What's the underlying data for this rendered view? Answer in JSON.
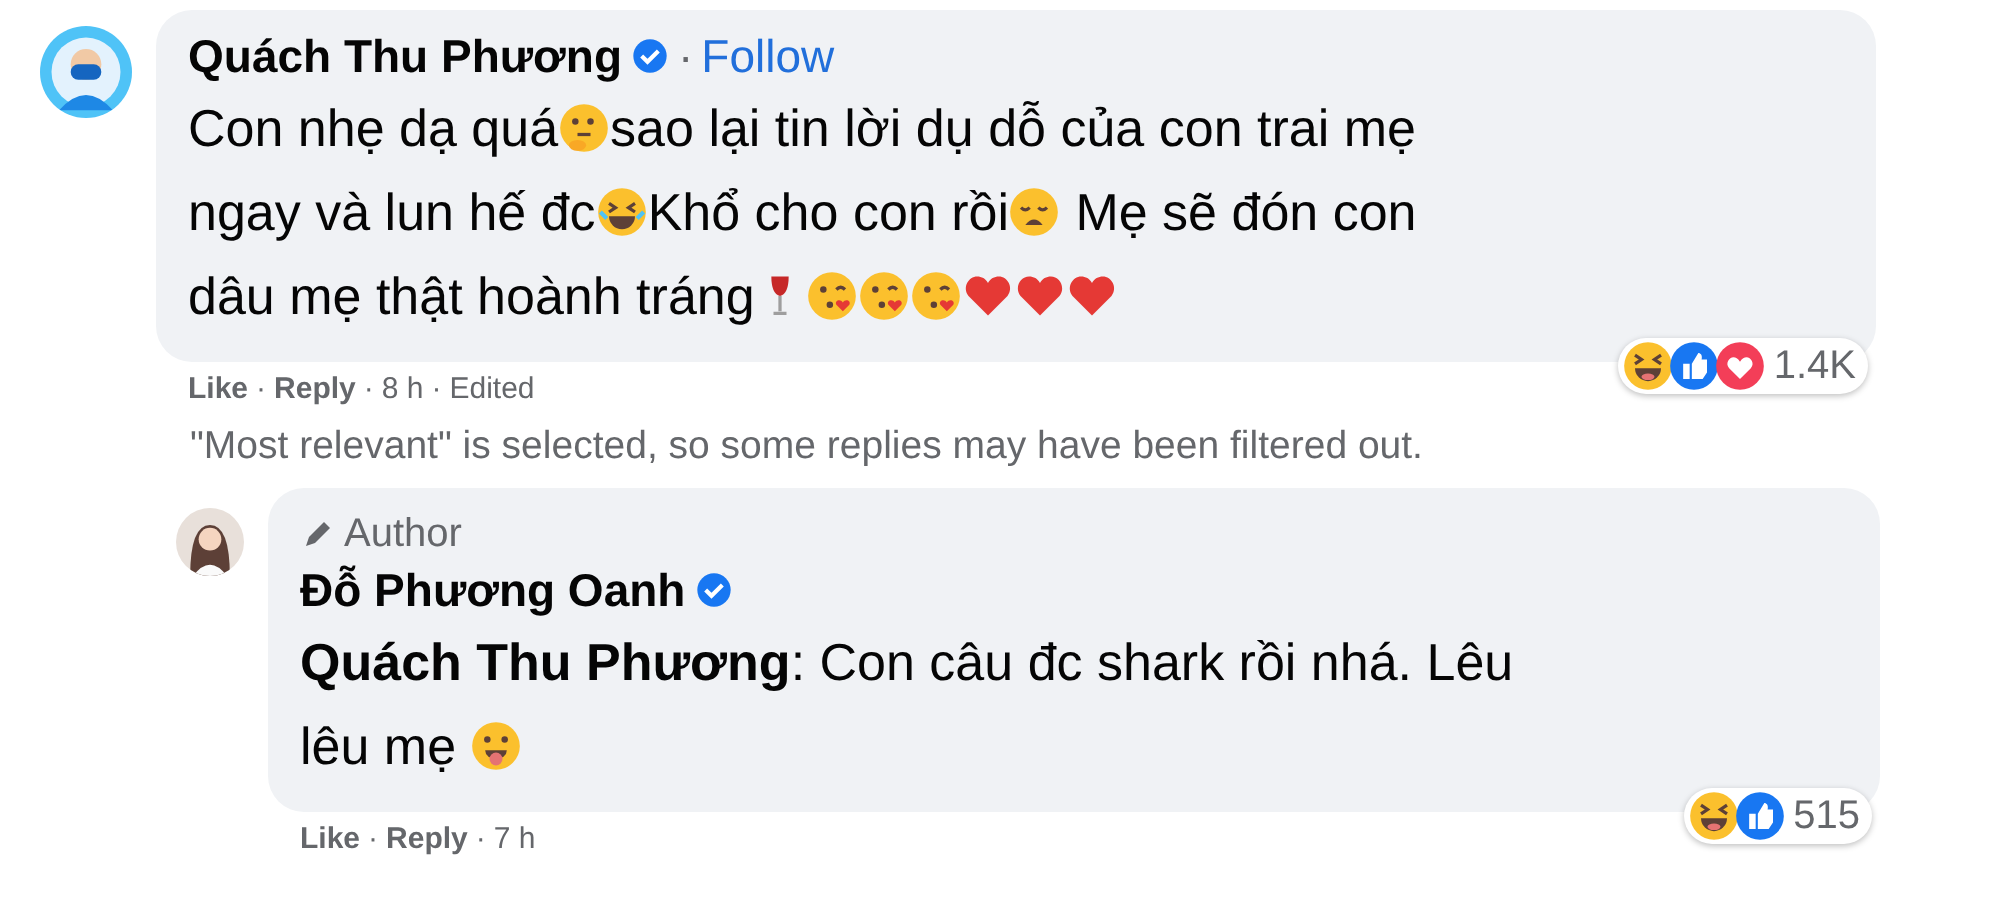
{
  "comments": [
    {
      "name": "Quách Thu Phương",
      "verified": true,
      "follow_separator": "·",
      "follow": "Follow",
      "message": [
        [
          {
            "kind": "text",
            "text": "Con nhẹ dạ quá"
          },
          {
            "kind": "thinking"
          },
          {
            "kind": "text",
            "text": "sao lại tin lời dụ dỗ của con trai mẹ"
          }
        ],
        [
          {
            "kind": "text",
            "text": "ngay và lun hế đc"
          },
          {
            "kind": "laughing"
          },
          {
            "kind": "text",
            "text": "Khổ cho con rồi"
          },
          {
            "kind": "weary"
          },
          {
            "kind": "text",
            "text": " Mẹ sẽ đón con"
          }
        ],
        [
          {
            "kind": "text",
            "text": "dâu mẹ thật hoành tráng"
          },
          {
            "kind": "wine"
          },
          {
            "kind": "kiss"
          },
          {
            "kind": "kiss"
          },
          {
            "kind": "kiss"
          },
          {
            "kind": "heart"
          },
          {
            "kind": "heart"
          },
          {
            "kind": "heart"
          }
        ]
      ],
      "reactions": {
        "icons": [
          {
            "kind": "haha"
          },
          {
            "kind": "like"
          },
          {
            "kind": "love"
          }
        ],
        "count": "1.4K"
      },
      "actions": [
        {
          "kind": "link",
          "text": "Like"
        },
        {
          "kind": "sep",
          "text": "·"
        },
        {
          "kind": "link",
          "text": "Reply"
        },
        {
          "kind": "sep",
          "text": "·"
        },
        {
          "kind": "info",
          "text": "8 h"
        },
        {
          "kind": "sep",
          "text": "·"
        },
        {
          "kind": "info",
          "text": "Edited"
        }
      ],
      "notice": "\"Most relevant\" is selected, so some replies may have been filtered out.",
      "replies": [
        {
          "author_label": "Author",
          "name": "Đỗ Phương Oanh",
          "verified": true,
          "message": [
            [
              {
                "kind": "text",
                "text": "**Quách Thu Phương**: Con câu đc shark rồi nhá. Lêu"
              }
            ],
            [
              {
                "kind": "text",
                "text": "lêu mẹ "
              },
              {
                "kind": "tongue"
              }
            ]
          ],
          "reactions": {
            "icons": [
              {
                "kind": "haha"
              },
              {
                "kind": "like"
              }
            ],
            "count": "515"
          },
          "actions": [
            {
              "kind": "link",
              "text": "Like"
            },
            {
              "kind": "sep",
              "text": "·"
            },
            {
              "kind": "link",
              "text": "Reply"
            },
            {
              "kind": "sep",
              "text": "·"
            },
            {
              "kind": "info",
              "text": "7 h"
            }
          ]
        }
      ]
    }
  ]
}
